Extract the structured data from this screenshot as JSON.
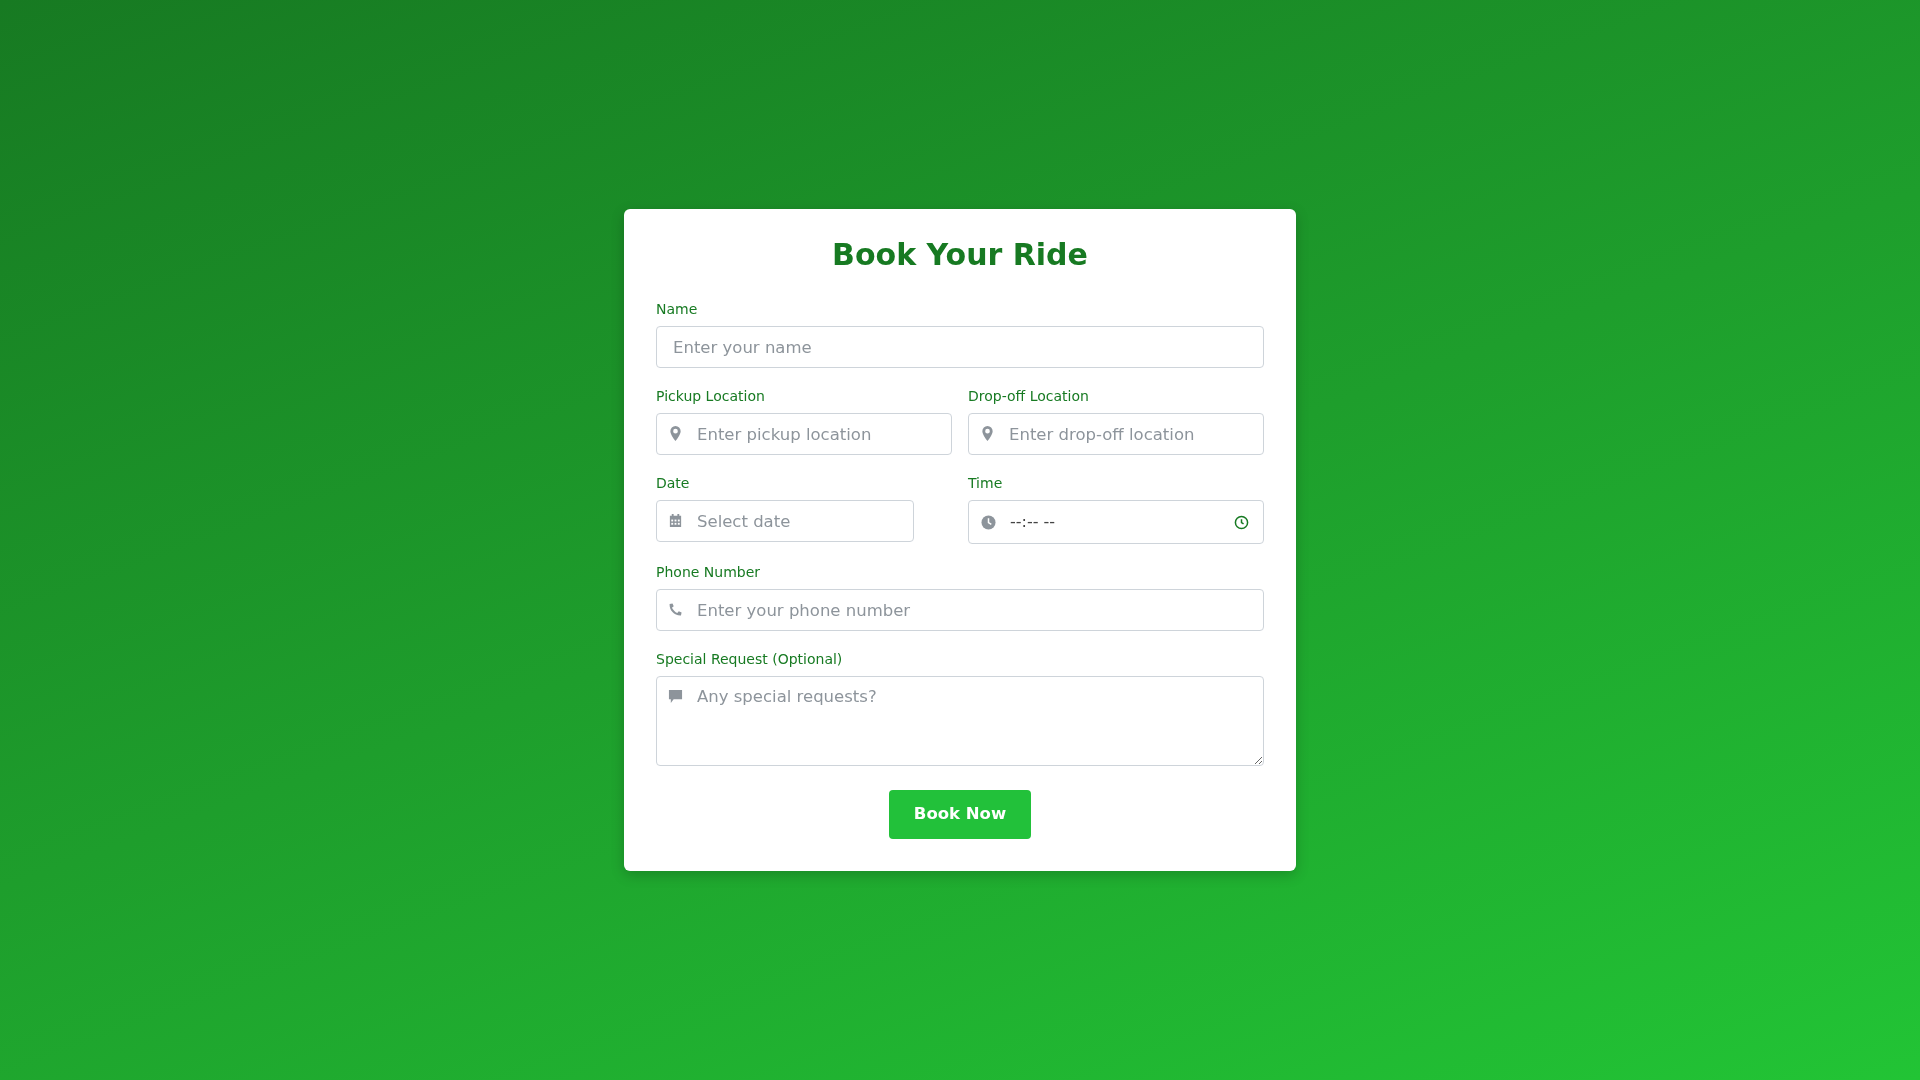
{
  "title": "Book Your Ride",
  "rows": [
    [
      {
        "label": "Name",
        "kind": "text",
        "placeholder": "Enter your name"
      }
    ],
    [
      {
        "label": "Pickup Location",
        "kind": "location",
        "placeholder": "Enter pickup location"
      },
      {
        "label": "Drop-off Location",
        "kind": "location",
        "placeholder": "Enter drop-off location"
      }
    ],
    [
      {
        "label": "Date",
        "kind": "date",
        "placeholder": "Select date"
      },
      {
        "label": "Time",
        "kind": "time",
        "value": "--:-- --"
      }
    ],
    [
      {
        "label": "Phone Number",
        "kind": "phone",
        "placeholder": "Enter your phone number"
      }
    ],
    [
      {
        "label": "Special Request (Optional)",
        "kind": "textarea",
        "placeholder": "Any special requests?"
      }
    ]
  ],
  "button": "Book Now"
}
